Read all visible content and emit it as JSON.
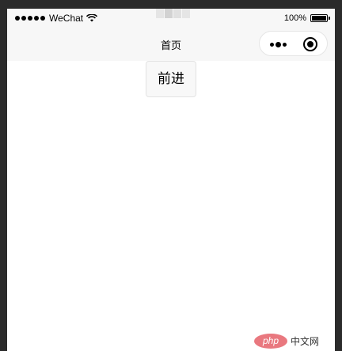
{
  "status_bar": {
    "signal_dots": 5,
    "carrier": "WeChat",
    "battery_text": "100%",
    "battery_level": 1.0
  },
  "nav_bar": {
    "title": "首页"
  },
  "content": {
    "forward_button_label": "前进"
  },
  "watermark": {
    "logo_text": "php",
    "site_text": "中文网"
  },
  "colors": {
    "bar_background": "#f7f7f7",
    "page_background": "#ffffff",
    "frame_background": "#2b2b2b",
    "watermark_logo": "#e9787f"
  }
}
